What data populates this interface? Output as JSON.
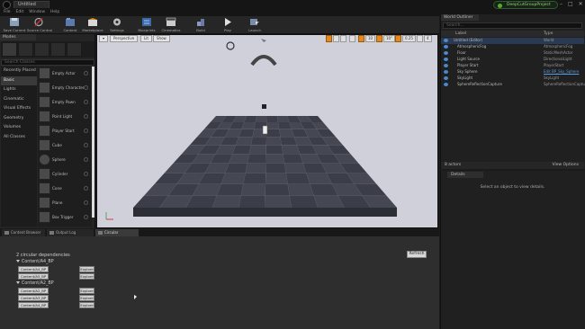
{
  "window": {
    "level_tab": "Untitled",
    "menu": [
      "File",
      "Edit",
      "Window",
      "Help"
    ],
    "project_badge": "DeepCutGroupProject",
    "controls": [
      "–",
      "□",
      "✕"
    ]
  },
  "toolbar": {
    "buttons": [
      "Save Current",
      "Source Control",
      "Content",
      "Marketplace",
      "Settings",
      "Blueprints",
      "Cinematics",
      "Build",
      "Play",
      "Launch"
    ]
  },
  "modes": {
    "tab": "Modes",
    "search_placeholder": "Search Classes",
    "categories": [
      "Recently Placed",
      "Basic",
      "Lights",
      "Cinematic",
      "Visual Effects",
      "Geometry",
      "Volumes",
      "All Classes"
    ],
    "active_category": 1,
    "items": [
      "Empty Actor",
      "Empty Character",
      "Empty Pawn",
      "Point Light",
      "Player Start",
      "Cube",
      "Sphere",
      "Cylinder",
      "Cone",
      "Plane",
      "Box Trigger"
    ]
  },
  "viewport": {
    "buttons": [
      "Perspective",
      "Lit",
      "Show"
    ],
    "grid_size": "10",
    "rot": "10°",
    "scale": "0.25",
    "cam_speed": "4"
  },
  "outliner": {
    "tab": "World Outliner",
    "search_placeholder": "Search...",
    "col_label": "Label",
    "col_type": "Type",
    "rows": [
      {
        "label": "Untitled (Editor)",
        "type": "World",
        "depth": 0
      },
      {
        "label": "AtmosphericFog",
        "type": "AtmosphericFog",
        "depth": 1
      },
      {
        "label": "Floor",
        "type": "StaticMeshActor",
        "depth": 1
      },
      {
        "label": "Light Source",
        "type": "DirectionalLight",
        "depth": 1
      },
      {
        "label": "Player Start",
        "type": "PlayerStart",
        "depth": 1
      },
      {
        "label": "Sky Sphere",
        "type": "Edit BP_Sky_Sphere",
        "depth": 1,
        "link": true
      },
      {
        "label": "SkyLight",
        "type": "SkyLight",
        "depth": 1
      },
      {
        "label": "SphereReflectionCapture",
        "type": "SphereReflectionCapture",
        "depth": 1
      }
    ],
    "footer_count": "8 actors",
    "view_options": "View Options"
  },
  "details": {
    "tab": "Details",
    "empty_text": "Select an object to view details."
  },
  "bottom": {
    "tabs": [
      "Content Browser",
      "Output Log",
      "Circular Dependencies"
    ],
    "active_tab": 2,
    "summary": "2 circular dependencies",
    "refresh": "Refresh",
    "groups": [
      {
        "title": "Content/A4_BP",
        "items": [
          "Content/A4_BP",
          "Content/A5_BP"
        ],
        "button": "Explore"
      },
      {
        "title": "Content/A2_BP",
        "items": [
          "Content/A2_BP",
          "Content/A3_BP",
          "Content/A4_BP"
        ],
        "button": "Explore"
      }
    ]
  },
  "colors": {
    "accent_orange": "#e48a1c",
    "selection_blue": "#4a8ad0",
    "floor_dark": "#3b3e48",
    "floor_light": "#454853",
    "viewport_bg": "#cfd0da"
  }
}
